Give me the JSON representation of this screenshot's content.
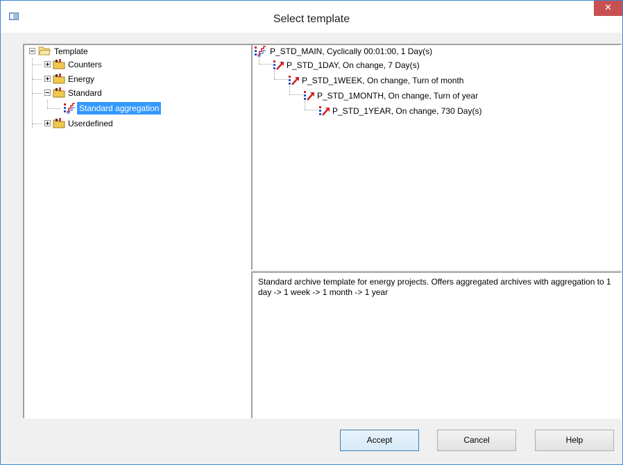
{
  "window": {
    "title": "Select template",
    "close_glyph": "✕",
    "accent": "#3c86d8",
    "close_color": "#c75050"
  },
  "tree": {
    "root": {
      "label": "Template",
      "icon": "folder-open-icon"
    },
    "items": [
      {
        "label": "Counters",
        "icon": "folder-icon",
        "expanded": false
      },
      {
        "label": "Energy",
        "icon": "folder-icon",
        "expanded": false
      },
      {
        "label": "Standard",
        "icon": "folder-icon",
        "expanded": true,
        "children": [
          {
            "label": "Standard aggregation",
            "icon": "aggregation-icon",
            "selected": true
          }
        ]
      },
      {
        "label": "Userdefined",
        "icon": "folder-icon",
        "expanded": false
      }
    ],
    "selection_color": "#3399ff"
  },
  "archives": [
    {
      "label": "P_STD_MAIN, Cyclically 00:01:00, 1 Day(s)",
      "icon": "main-archive-icon"
    },
    {
      "label": "P_STD_1DAY, On change, 7 Day(s)",
      "icon": "aggregated-archive-icon"
    },
    {
      "label": "P_STD_1WEEK, On change, Turn of month",
      "icon": "aggregated-archive-icon"
    },
    {
      "label": "P_STD_1MONTH, On change, Turn of year",
      "icon": "aggregated-archive-icon"
    },
    {
      "label": "P_STD_1YEAR, On change, 730 Day(s)",
      "icon": "aggregated-archive-icon"
    }
  ],
  "description": "Standard archive template for energy projects. Offers aggregated archives with aggregation to 1 day -> 1 week -> 1 month -> 1 year",
  "buttons": {
    "accept": "Accept",
    "cancel": "Cancel",
    "help": "Help"
  }
}
